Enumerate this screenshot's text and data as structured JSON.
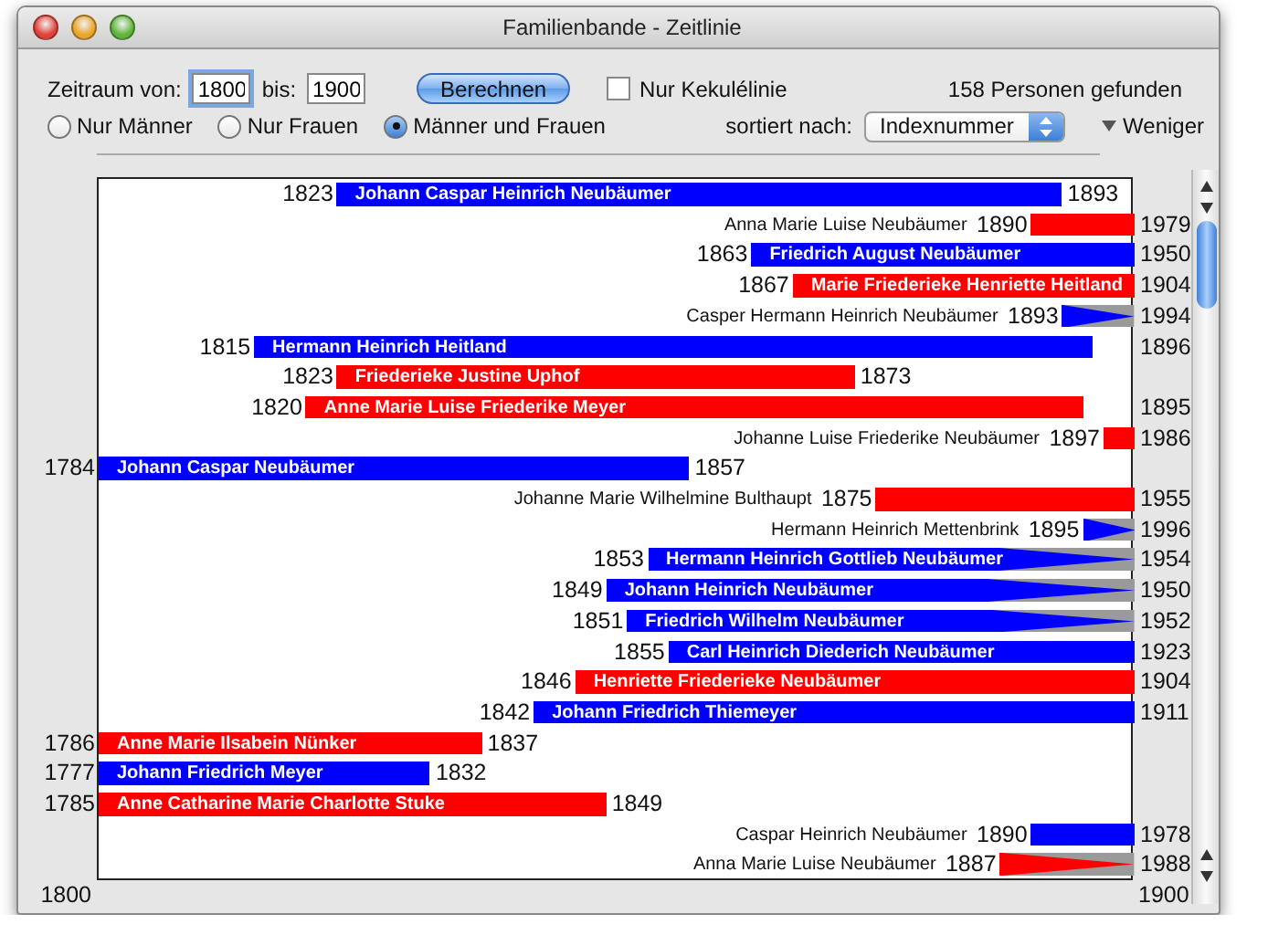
{
  "window": {
    "title": "Familienbande - Zeitlinie"
  },
  "controls": {
    "from_label": "Zeitraum von:",
    "from_value": "1800",
    "to_label": "bis:",
    "to_value": "1900",
    "button": "Berechnen",
    "checkbox": {
      "label": "Nur Kekulélinie",
      "checked": false
    },
    "count": "158 Personen gefunden",
    "sort_label": "sortiert nach:",
    "sort_value": "Indexnummer",
    "toggle": {
      "label": "Weniger",
      "expanded": true
    }
  },
  "radios": [
    {
      "label": "Nur Männer",
      "selected": false
    },
    {
      "label": "Nur Frauen",
      "selected": false
    },
    {
      "label": "Männer und Frauen",
      "selected": true
    }
  ],
  "axis": {
    "start": "1800",
    "end": "1900"
  },
  "rows": [
    {
      "name": "Johann Caspar Heinrich Neubäumer",
      "birth": "1823",
      "death": "1893",
      "color": "#0000ff",
      "kind": "solid"
    },
    {
      "name": "Anna Marie Luise Neubäumer",
      "birth": "1890",
      "death": "1979",
      "color": "#ff0000",
      "kind": "solid"
    },
    {
      "name": "Friedrich August Neubäumer",
      "birth": "1863",
      "death": "1950",
      "color": "#0000ff",
      "kind": "solid"
    },
    {
      "name": "Marie Friederieke Henriette Heitland",
      "birth": "1867",
      "death": "1904",
      "color": "#ff0000",
      "kind": "solid"
    },
    {
      "name": "Casper Hermann Heinrich Neubäumer",
      "birth": "1893",
      "death": "1994",
      "color": "#0000ff",
      "kind": "taper"
    },
    {
      "name": "Hermann Heinrich Heitland",
      "birth": "1815",
      "death": "1896",
      "color": "#0000ff",
      "kind": "solid"
    },
    {
      "name": "Friederieke Justine Uphof",
      "birth": "1823",
      "death": "1873",
      "color": "#ff0000",
      "kind": "solid"
    },
    {
      "name": "Anne Marie Luise Friederike Meyer",
      "birth": "1820",
      "death": "1895",
      "color": "#ff0000",
      "kind": "solid"
    },
    {
      "name": "Johanne Luise Friederike Neubäumer",
      "birth": "1897",
      "death": "1986",
      "color": "#ff0000",
      "kind": "solid"
    },
    {
      "name": "Johann Caspar Neubäumer",
      "birth": "1784",
      "death": "1857",
      "color": "#0000ff",
      "kind": "solid"
    },
    {
      "name": "Johanne Marie Wilhelmine Bulthaupt",
      "birth": "1875",
      "death": "1955",
      "color": "#ff0000",
      "kind": "solid"
    },
    {
      "name": "Hermann Heinrich Mettenbrink",
      "birth": "1895",
      "death": "1996",
      "color": "#0000ff",
      "kind": "taper"
    },
    {
      "name": "Hermann Heinrich Gottlieb Neubäumer",
      "birth": "1853",
      "death": "1954",
      "color": "#0000ff",
      "kind": "taper"
    },
    {
      "name": "Johann Heinrich Neubäumer",
      "birth": "1849",
      "death": "1950",
      "color": "#0000ff",
      "kind": "taper"
    },
    {
      "name": "Friedrich Wilhelm Neubäumer",
      "birth": "1851",
      "death": "1952",
      "color": "#0000ff",
      "kind": "taper"
    },
    {
      "name": "Carl Heinrich Diederich Neubäumer",
      "birth": "1855",
      "death": "1923",
      "color": "#0000ff",
      "kind": "solid"
    },
    {
      "name": "Henriette Friederieke Neubäumer",
      "birth": "1846",
      "death": "1904",
      "color": "#ff0000",
      "kind": "solid"
    },
    {
      "name": "Johann Friedrich Thiemeyer",
      "birth": "1842",
      "death": "1911",
      "color": "#0000ff",
      "kind": "solid"
    },
    {
      "name": "Anne Marie Ilsabein Nünker",
      "birth": "1786",
      "death": "1837",
      "color": "#ff0000",
      "kind": "solid"
    },
    {
      "name": "Johann Friedrich Meyer",
      "birth": "1777",
      "death": "1832",
      "color": "#0000ff",
      "kind": "solid"
    },
    {
      "name": "Anne Catharine Marie Charlotte Stuke",
      "birth": "1785",
      "death": "1849",
      "color": "#ff0000",
      "kind": "solid"
    },
    {
      "name": "Caspar Heinrich Neubäumer",
      "birth": "1890",
      "death": "1978",
      "color": "#0000ff",
      "kind": "solid"
    },
    {
      "name": "Anna Marie Luise Neubäumer",
      "birth": "1887",
      "death": "1988",
      "color": "#ff0000",
      "kind": "taper"
    }
  ]
}
